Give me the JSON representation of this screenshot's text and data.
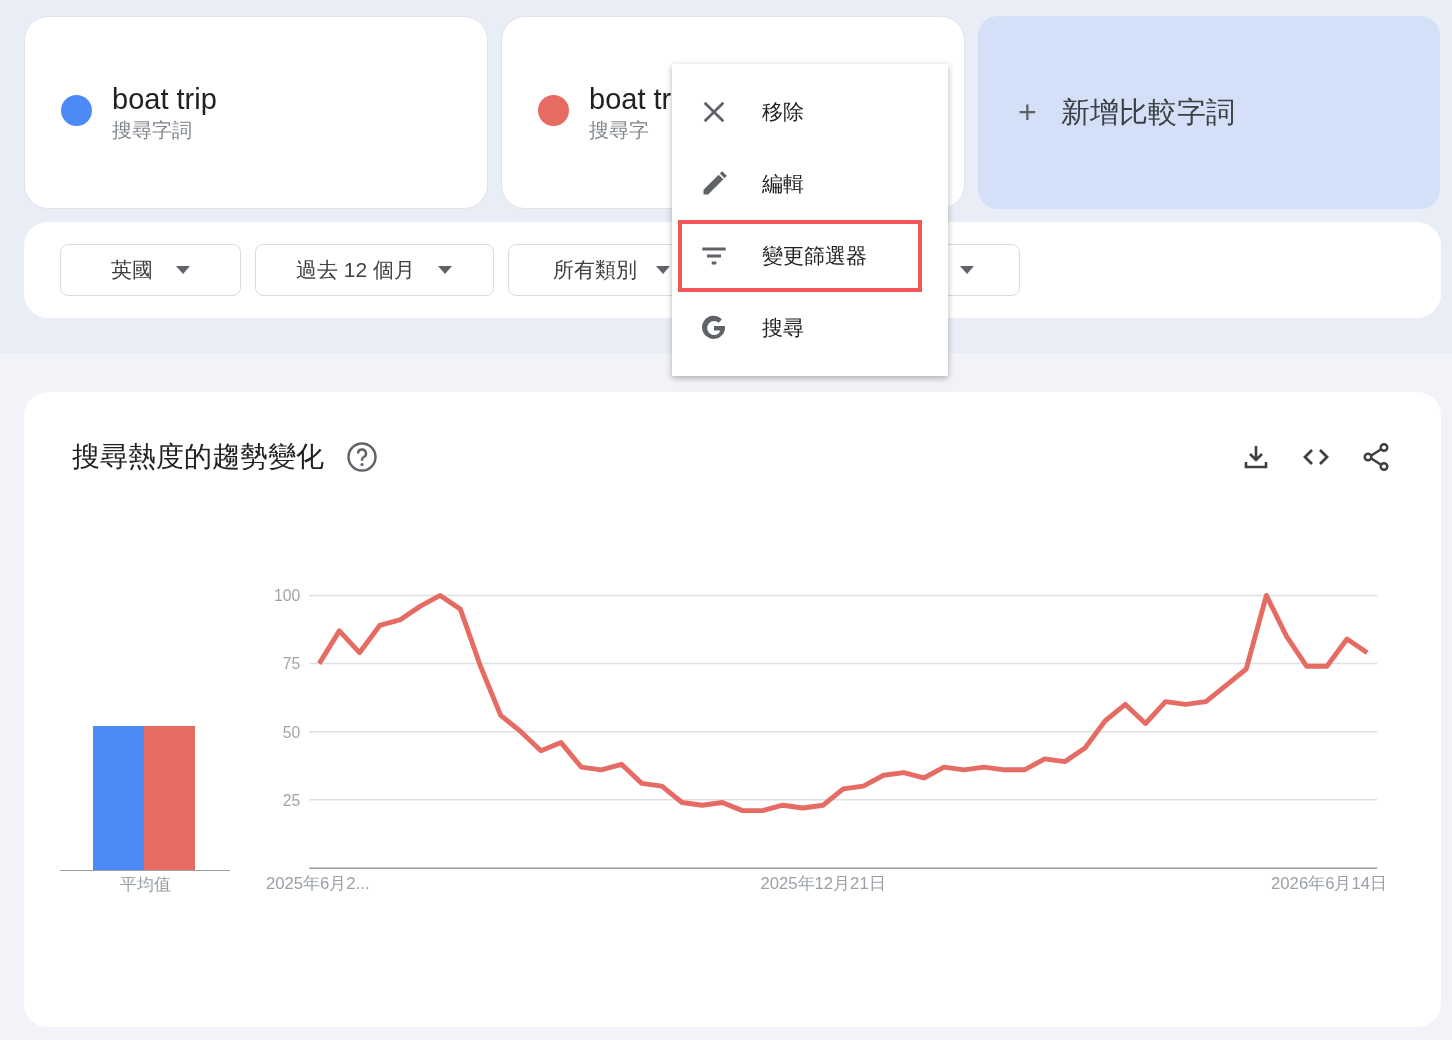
{
  "terms": [
    {
      "title": "boat trip",
      "subtitle": "搜尋字詞",
      "color": "#4c8bf5"
    },
    {
      "title": "boat tr",
      "subtitle": "搜尋字",
      "color": "#e56b63"
    }
  ],
  "add_term": {
    "icon": "+",
    "label": "新增比較字詞"
  },
  "filters": [
    {
      "kind": "dropdown",
      "label": "英國"
    },
    {
      "kind": "dropdown",
      "label": "過去 12 個月"
    },
    {
      "kind": "dropdown",
      "label": "所有類別"
    },
    {
      "kind": "dropdown"
    }
  ],
  "menu": {
    "items": [
      {
        "kind": "close",
        "label": "移除",
        "highlighted": false
      },
      {
        "kind": "edit",
        "label": "編輯",
        "highlighted": false
      },
      {
        "kind": "filter",
        "label": "變更篩選器",
        "highlighted": true
      },
      {
        "kind": "google",
        "label": "搜尋",
        "highlighted": false
      }
    ]
  },
  "chart_card": {
    "title": "搜尋熱度的趨勢變化",
    "average": {
      "label": "平均值",
      "bars": [
        {
          "color": "#4c8bf5",
          "level": 0.52
        },
        {
          "color": "#e56b63",
          "level": 0.52
        }
      ]
    },
    "chart_data": {
      "type": "line",
      "categories": [
        "2025年6月2...",
        null,
        null,
        null,
        null,
        null,
        null,
        null,
        null,
        null,
        null,
        null,
        null,
        null,
        null,
        null,
        null,
        null,
        null,
        null,
        null,
        null,
        null,
        null,
        null,
        "2025年12月21日",
        null,
        null,
        null,
        null,
        null,
        null,
        null,
        null,
        null,
        null,
        null,
        null,
        null,
        null,
        null,
        null,
        null,
        null,
        null,
        null,
        null,
        null,
        null,
        null,
        "2026年6月14日",
        null,
        null
      ],
      "series": [
        {
          "color": "#e56b63",
          "values": [
            75,
            87,
            79,
            89,
            91,
            96,
            100,
            95,
            74,
            56,
            50,
            43,
            46,
            37,
            36,
            38,
            31,
            30,
            24,
            23,
            24,
            21,
            21,
            23,
            22,
            23,
            29,
            30,
            34,
            35,
            33,
            37,
            36,
            37,
            36,
            36,
            40,
            39,
            44,
            54,
            60,
            53,
            61,
            60,
            61,
            67,
            73,
            100,
            85,
            74,
            74,
            84,
            79
          ]
        }
      ],
      "ylim": [
        0,
        100
      ],
      "yticks": [
        25,
        50,
        75,
        100
      ],
      "grid": true
    }
  }
}
